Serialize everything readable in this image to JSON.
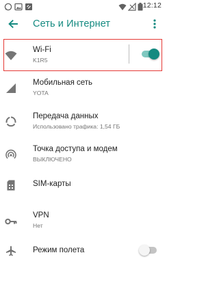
{
  "status_bar": {
    "time": "12:12",
    "left_icons": [
      "whatsapp-icon",
      "picture-icon",
      "screenshot-icon"
    ],
    "right_icons": [
      "wifi-signal-icon",
      "no-sim-signal-icon",
      "battery-icon"
    ]
  },
  "toolbar": {
    "title": "Сеть и Интернет"
  },
  "settings": {
    "wifi": {
      "title": "Wi-Fi",
      "subtitle": "K1R5",
      "enabled": true
    },
    "mobile": {
      "title": "Мобильная сеть",
      "subtitle": "YOTA"
    },
    "data": {
      "title": "Передача данных",
      "subtitle": "Использовано трафика: 1,54 ГБ"
    },
    "hotspot": {
      "title": "Точка доступа и модем",
      "subtitle": "ВЫКЛЮЧЕНО"
    },
    "sim": {
      "title": "SIM-карты"
    },
    "vpn": {
      "title": "VPN",
      "subtitle": "Нет"
    },
    "airplane": {
      "title": "Режим полета",
      "enabled": false
    }
  },
  "colors": {
    "accent": "#148a80",
    "switch_on_thumb": "#148a80",
    "switch_on_track": "#7fc8c0",
    "switch_off_thumb": "#f5f5f5",
    "switch_off_track": "#c4c4c4",
    "highlight": "#e53935",
    "icon_grey": "#757575"
  }
}
